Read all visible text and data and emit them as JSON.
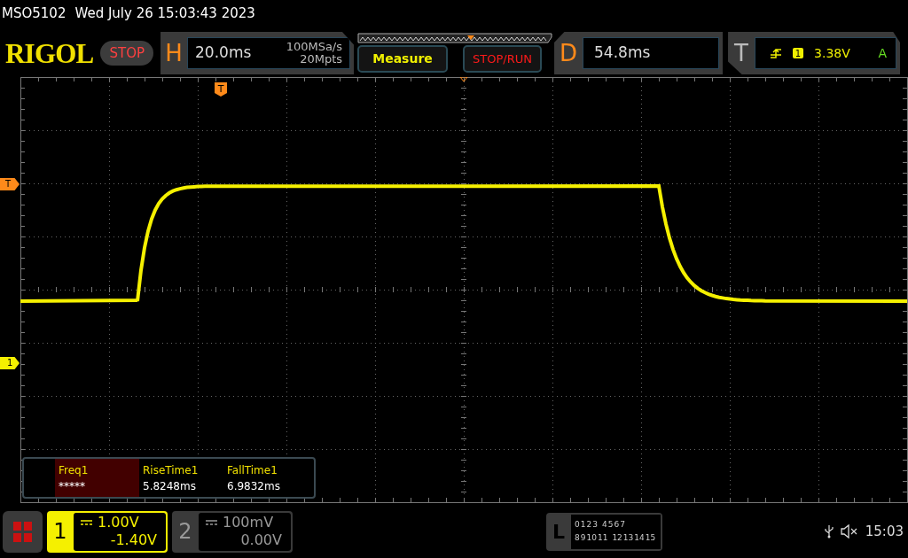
{
  "header": {
    "model": "MSO5102",
    "datetime": "Wed July 26 15:03:43 2023"
  },
  "toolbar": {
    "logo": "RIGOL",
    "run_state": "STOP",
    "horizontal": {
      "label": "H",
      "timebase": "20.0ms",
      "sample_rate": "100MSa/s",
      "memory_depth": "20Mpts"
    },
    "measure_button": "Measure",
    "stop_run_button": "STOP/RUN",
    "delay": {
      "label": "D",
      "value": "54.8ms"
    },
    "trigger": {
      "label": "T",
      "source": "1",
      "level": "3.38V",
      "mode": "A"
    }
  },
  "markers": {
    "trigger_position": "T",
    "trigger_level": "T",
    "channel_1": "1"
  },
  "measurements": [
    {
      "name": "Freq1",
      "value": "*****",
      "selected": true
    },
    {
      "name": "RiseTime1",
      "value": "5.8248ms",
      "selected": false
    },
    {
      "name": "FallTime1",
      "value": "6.9832ms",
      "selected": false
    }
  ],
  "channels": [
    {
      "number": "1",
      "scale": "1.00V",
      "offset": "-1.40V",
      "selected": true
    },
    {
      "number": "2",
      "scale": "100mV",
      "offset": "0.00V",
      "selected": false
    }
  ],
  "logic": {
    "label": "L",
    "row_1": [
      "0",
      "1",
      "2",
      "3",
      "4",
      "5",
      "6",
      "7"
    ],
    "row_2": [
      "8",
      "9",
      "10",
      "11",
      "12",
      "13",
      "14",
      "15"
    ]
  },
  "status_bar": {
    "time": "15:03"
  }
}
